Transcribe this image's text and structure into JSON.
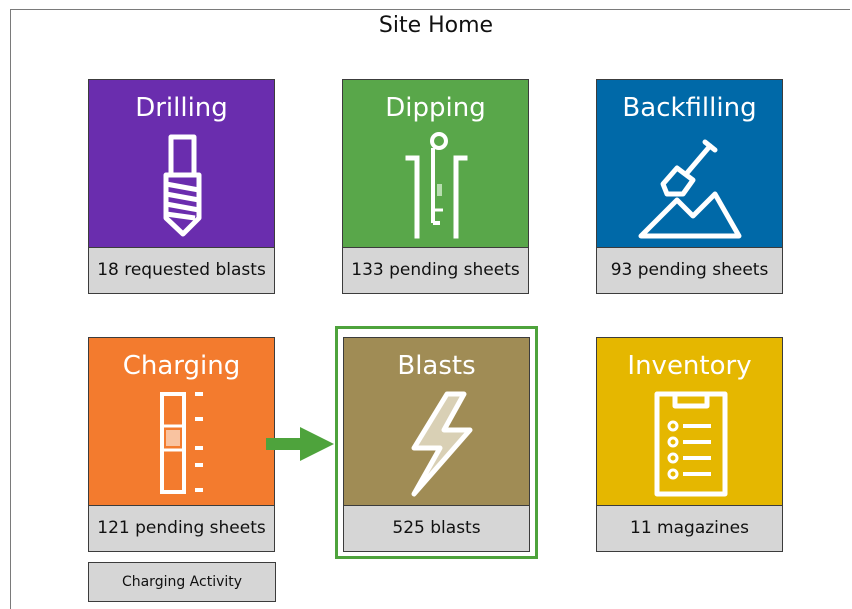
{
  "page": {
    "title": "Site Home"
  },
  "tiles": {
    "drilling": {
      "label": "Drilling",
      "status": "18 requested blasts",
      "color": "#6a2dae"
    },
    "dipping": {
      "label": "Dipping",
      "status": "133 pending sheets",
      "color": "#59a74a"
    },
    "backfilling": {
      "label": "Backfilling",
      "status": "93 pending sheets",
      "color": "#0069a8"
    },
    "charging": {
      "label": "Charging",
      "status": "121 pending sheets",
      "color": "#f37b2e"
    },
    "blasts": {
      "label": "Blasts",
      "status": "525 blasts",
      "color": "#a08c55",
      "selected": true
    },
    "inventory": {
      "label": "Inventory",
      "status": "11 magazines",
      "color": "#e5b700"
    }
  },
  "buttons": {
    "charging_activity": "Charging Activity"
  },
  "icons": [
    "drill-bit-icon",
    "dipping-tube-icon",
    "shovel-mountain-icon",
    "charging-column-icon",
    "lightning-bolt-icon",
    "clipboard-checklist-icon",
    "arrow-right-icon"
  ]
}
